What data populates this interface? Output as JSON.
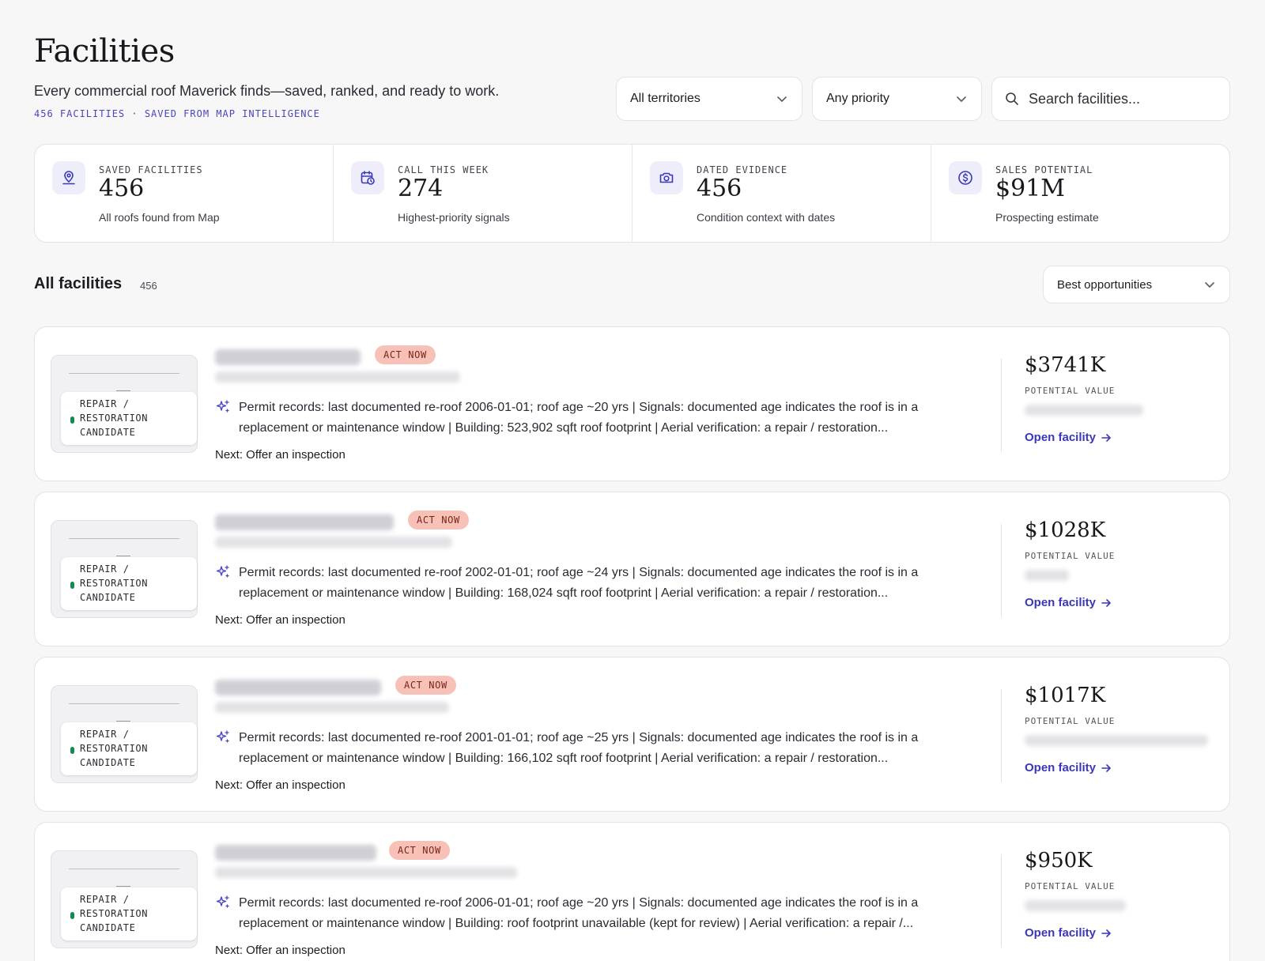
{
  "header": {
    "title": "Facilities",
    "subtitle": "Every commercial roof Maverick finds—saved, ranked, and ready to work.",
    "meta": "456 FACILITIES · SAVED FROM MAP INTELLIGENCE"
  },
  "filters": {
    "territory": "All territories",
    "priority": "Any priority",
    "search_placeholder": "Search facilities..."
  },
  "stats": [
    {
      "label": "SAVED FACILITIES",
      "value": "456",
      "caption": "All roofs found from Map",
      "icon": "map-pin-icon"
    },
    {
      "label": "CALL THIS WEEK",
      "value": "274",
      "caption": "Highest-priority signals",
      "icon": "calendar-clock-icon"
    },
    {
      "label": "DATED EVIDENCE",
      "value": "456",
      "caption": "Condition context with dates",
      "icon": "camera-icon"
    },
    {
      "label": "SALES POTENTIAL",
      "value": "$91M",
      "caption": "Prospecting estimate",
      "icon": "dollar-circle-icon"
    }
  ],
  "list": {
    "title": "All facilities",
    "count": "456",
    "sort": "Best opportunities"
  },
  "cards": [
    {
      "badge": "ACT NOW",
      "thumb_label": "REPAIR / RESTORATION CANDIDATE",
      "summary": "Permit records: last documented re-roof 2006-01-01; roof age ~20 yrs | Signals: documented age indicates the roof is in a replacement or maintenance window | Building: 523,902 sqft roof footprint | Aerial verification: a repair / restoration...",
      "next": "Next: Offer an inspection",
      "value": "$3741K",
      "value_label": "POTENTIAL VALUE",
      "link": "Open facility"
    },
    {
      "badge": "ACT NOW",
      "thumb_label": "REPAIR / RESTORATION CANDIDATE",
      "summary": "Permit records: last documented re-roof 2002-01-01; roof age ~24 yrs | Signals: documented age indicates the roof is in a replacement or maintenance window | Building: 168,024 sqft roof footprint | Aerial verification: a repair / restoration...",
      "next": "Next: Offer an inspection",
      "value": "$1028K",
      "value_label": "POTENTIAL VALUE",
      "link": "Open facility"
    },
    {
      "badge": "ACT NOW",
      "thumb_label": "REPAIR / RESTORATION CANDIDATE",
      "summary": "Permit records: last documented re-roof 2001-01-01; roof age ~25 yrs | Signals: documented age indicates the roof is in a replacement or maintenance window | Building: 166,102 sqft roof footprint | Aerial verification: a repair / restoration...",
      "next": "Next: Offer an inspection",
      "value": "$1017K",
      "value_label": "POTENTIAL VALUE",
      "link": "Open facility"
    },
    {
      "badge": "ACT NOW",
      "thumb_label": "REPAIR / RESTORATION CANDIDATE",
      "summary": "Permit records: last documented re-roof 2006-01-01; roof age ~20 yrs | Signals: documented age indicates the roof is in a replacement or maintenance window | Building: roof footprint unavailable (kept for review) | Aerial verification: a repair /...",
      "next": "Next: Offer an inspection",
      "value": "$950K",
      "value_label": "POTENTIAL VALUE",
      "link": "Open facility"
    }
  ],
  "colors": {
    "accent": "#3b37b8",
    "badge_bg": "#f8c1b7",
    "badge_text": "#7a2418",
    "status_dot": "#138a4e"
  }
}
